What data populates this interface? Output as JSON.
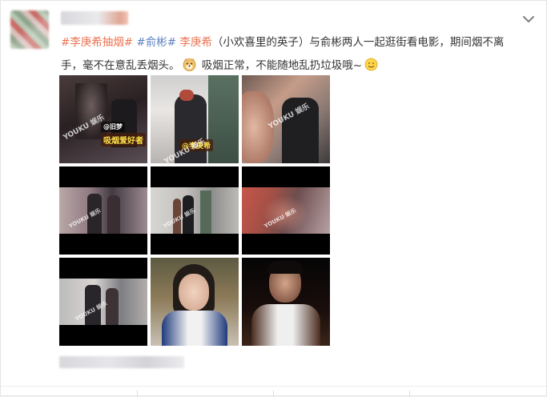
{
  "post": {
    "segments": [
      {
        "type": "topic",
        "text": "#李庚希抽烟#"
      },
      {
        "type": "text",
        "text": " "
      },
      {
        "type": "topic-blue",
        "text": "#俞彬#"
      },
      {
        "type": "text",
        "text": " "
      },
      {
        "type": "mention",
        "text": "李庚希"
      },
      {
        "type": "text",
        "text": "（小欢喜里的英子）与俞彬两人一起逛街看电影，期间烟不离手，毫不在意乱丢烟头。"
      },
      {
        "type": "emoji",
        "name": "doge-emoji"
      },
      {
        "type": "text",
        "text": " 吸烟正常，不能随地乱扔垃圾哦~"
      },
      {
        "type": "emoji",
        "name": "smile-emoji"
      }
    ]
  },
  "grid": {
    "watermark": "YOUKU 娱乐",
    "captions": {
      "tile1": "吸烟爱好者",
      "tile1_small": "@旧梦",
      "tile2": "@李庚希"
    },
    "tiles": [
      {
        "name": "photo-1",
        "kind": "dark-video"
      },
      {
        "name": "photo-2",
        "kind": "street"
      },
      {
        "name": "photo-3",
        "kind": "closeup"
      },
      {
        "name": "photo-4",
        "kind": "letterbox"
      },
      {
        "name": "photo-5",
        "kind": "letterbox"
      },
      {
        "name": "photo-6",
        "kind": "letterbox-red"
      },
      {
        "name": "photo-7",
        "kind": "letterbox"
      },
      {
        "name": "photo-8",
        "kind": "portrait-girl"
      },
      {
        "name": "photo-9",
        "kind": "portrait-boy"
      }
    ]
  },
  "colors": {
    "topic": "#eb7350",
    "topic_blue": "#5b7fbd",
    "text": "#333333",
    "card_bg": "#ffffff",
    "page_bg": "#f2f2f5"
  },
  "icons": {
    "menu": "chevron-down-icon"
  }
}
